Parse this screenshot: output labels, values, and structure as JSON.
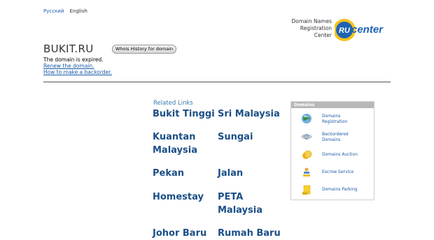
{
  "languages": [
    "Русский",
    "English"
  ],
  "logo": {
    "caption_lines": [
      "Domain Names",
      "Registration",
      "Center"
    ],
    "mark_text": "RU",
    "word_text": "center",
    "colors": {
      "blue": "#1e63b4",
      "yellow": "#f6c21c"
    }
  },
  "domain": {
    "name": "BUKIT.RU",
    "whois_button": "Whois History for domain",
    "status": "The domain is expired.",
    "renew_link": "Renew the domain.",
    "backorder_link": "How to make a backorder."
  },
  "related": {
    "header": "Related Links",
    "links": [
      "Bukit Tinggi",
      "Sri Malaysia",
      "Kuantan Malaysia",
      "Sungai",
      "Pekan",
      "Jalan",
      "Homestay",
      "PETA Malaysia",
      "Johor Baru",
      "Rumah Baru"
    ]
  },
  "services": {
    "header": "Domains",
    "items": [
      {
        "label": "Domains Registration",
        "icon": "globe-icon"
      },
      {
        "label": "Backordered Domains",
        "icon": "ru-wings-icon"
      },
      {
        "label": "Domains Auction",
        "icon": "coins-icon"
      },
      {
        "label": "Escrow Service",
        "icon": "escrow-icon"
      },
      {
        "label": "Domains Parking",
        "icon": "parking-icon"
      }
    ]
  }
}
